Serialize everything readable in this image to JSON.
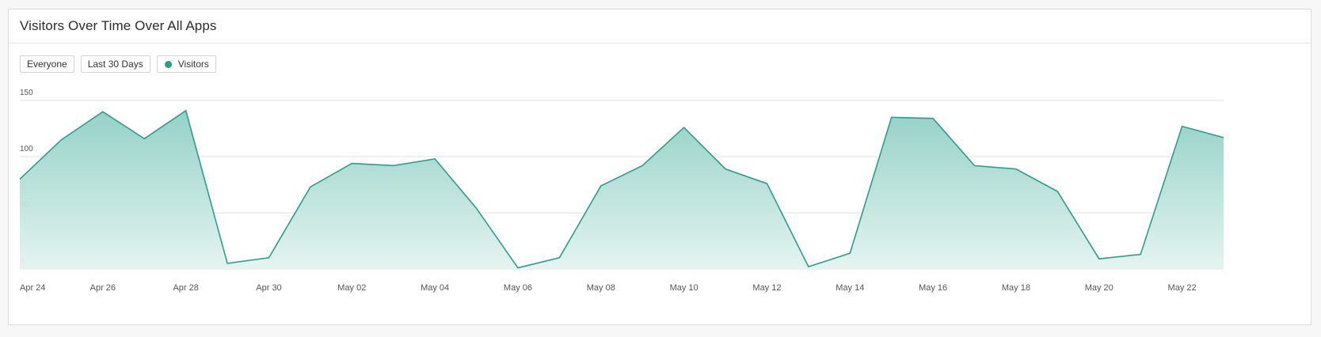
{
  "card": {
    "title": "Visitors Over Time Over All Apps"
  },
  "filters": {
    "audience": "Everyone",
    "range": "Last 30 Days",
    "series_label": "Visitors"
  },
  "colors": {
    "line": "#2a9d8f",
    "fill_top": "#8fcfc4",
    "fill_bottom": "#e3f3f0",
    "grid": "#e2e2e2",
    "axis_text": "#555555"
  },
  "chart_data": {
    "type": "area",
    "x": [
      "Apr 24",
      "Apr 25",
      "Apr 26",
      "Apr 27",
      "Apr 28",
      "Apr 29",
      "Apr 30",
      "May 01",
      "May 02",
      "May 03",
      "May 04",
      "May 05",
      "May 06",
      "May 07",
      "May 08",
      "May 09",
      "May 10",
      "May 11",
      "May 12",
      "May 13",
      "May 14",
      "May 15",
      "May 16",
      "May 17",
      "May 18",
      "May 19",
      "May 20",
      "May 21",
      "May 22",
      "May 23"
    ],
    "x_tick_labels": [
      "Apr 24",
      "Apr 26",
      "Apr 28",
      "Apr 30",
      "May 02",
      "May 04",
      "May 06",
      "May 08",
      "May 10",
      "May 12",
      "May 14",
      "May 16",
      "May 18",
      "May 20",
      "May 22"
    ],
    "series": [
      {
        "name": "Visitors",
        "values": [
          80,
          115,
          140,
          116,
          141,
          5,
          10,
          73,
          94,
          92,
          98,
          54,
          1,
          10,
          74,
          92,
          126,
          89,
          76,
          2,
          14,
          135,
          134,
          92,
          89,
          69,
          9,
          13,
          127,
          117
        ]
      }
    ],
    "y_ticks": [
      0,
      50,
      100,
      150
    ],
    "ylim": [
      0,
      150
    ],
    "grid": true,
    "legend": "top-left"
  }
}
